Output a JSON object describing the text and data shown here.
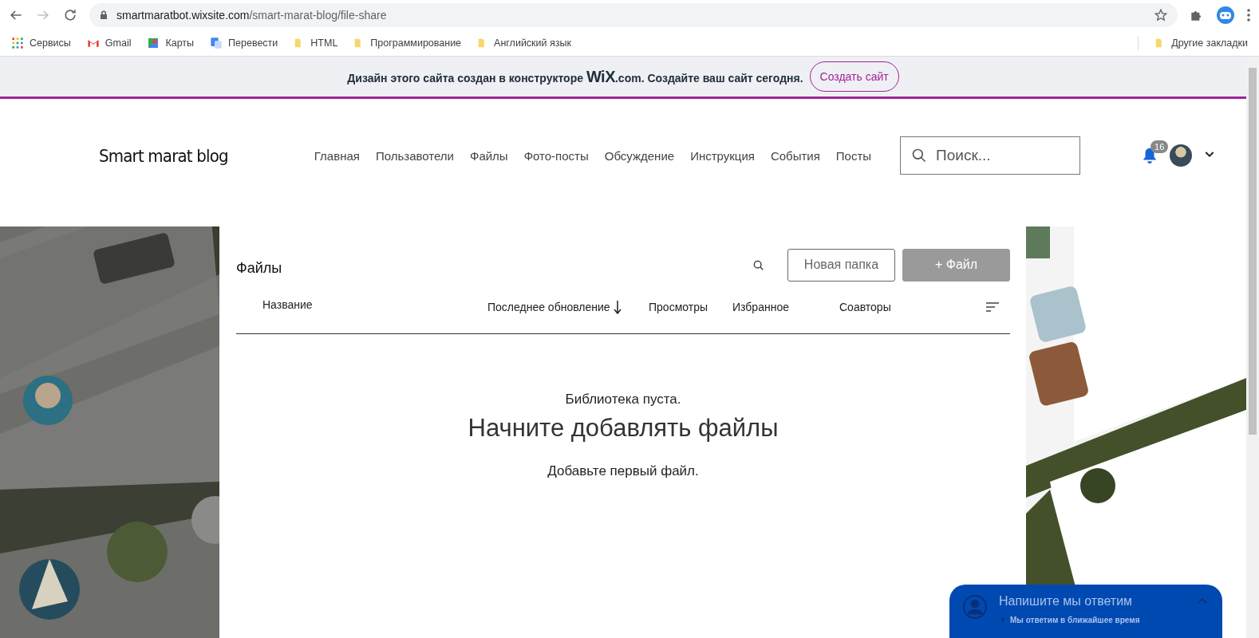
{
  "browser": {
    "url_host": "smartmaratbot.wixsite.com",
    "url_path": "/smart-marat-blog/file-share",
    "bookmarks": [
      {
        "label": "Сервисы",
        "kind": "apps"
      },
      {
        "label": "Gmail",
        "kind": "gmail"
      },
      {
        "label": "Карты",
        "kind": "maps"
      },
      {
        "label": "Перевести",
        "kind": "translate"
      },
      {
        "label": "HTML",
        "kind": "folder"
      },
      {
        "label": "Программирование",
        "kind": "folder"
      },
      {
        "label": "Английский язык",
        "kind": "folder"
      }
    ],
    "other_bookmarks": "Другие закладки"
  },
  "banner": {
    "text": "Дизайн этого сайта создан в конструкторе **WiX**.com. Создайте ваш сайт сегодня.",
    "button": "Создать сайт"
  },
  "site": {
    "title": "Smart marat blog",
    "nav": [
      "Главная",
      "Пользавотели",
      "Файлы",
      "Фото-посты",
      "Обсуждение",
      "Инструкция",
      "События",
      "Посты"
    ],
    "search_placeholder": "Поиск...",
    "notifications": "16"
  },
  "files": {
    "title": "Файлы",
    "new_folder": "Новая папка",
    "add_file": "+ Файл",
    "columns": [
      {
        "label": "Название",
        "sorted": false
      },
      {
        "label": "Последнее обновление",
        "sorted": true
      },
      {
        "label": "Просмотры",
        "sorted": false
      },
      {
        "label": "Избранное",
        "sorted": false
      },
      {
        "label": "Соавторы",
        "sorted": false
      }
    ],
    "empty": {
      "note": "Библиотека пуста.",
      "heading": "Начните добавлять файлы",
      "hint": "Добавьте первый файл."
    }
  },
  "chat": {
    "title": "Напишите мы ответим",
    "subtitle": "Мы ответим в ближайшее время"
  }
}
